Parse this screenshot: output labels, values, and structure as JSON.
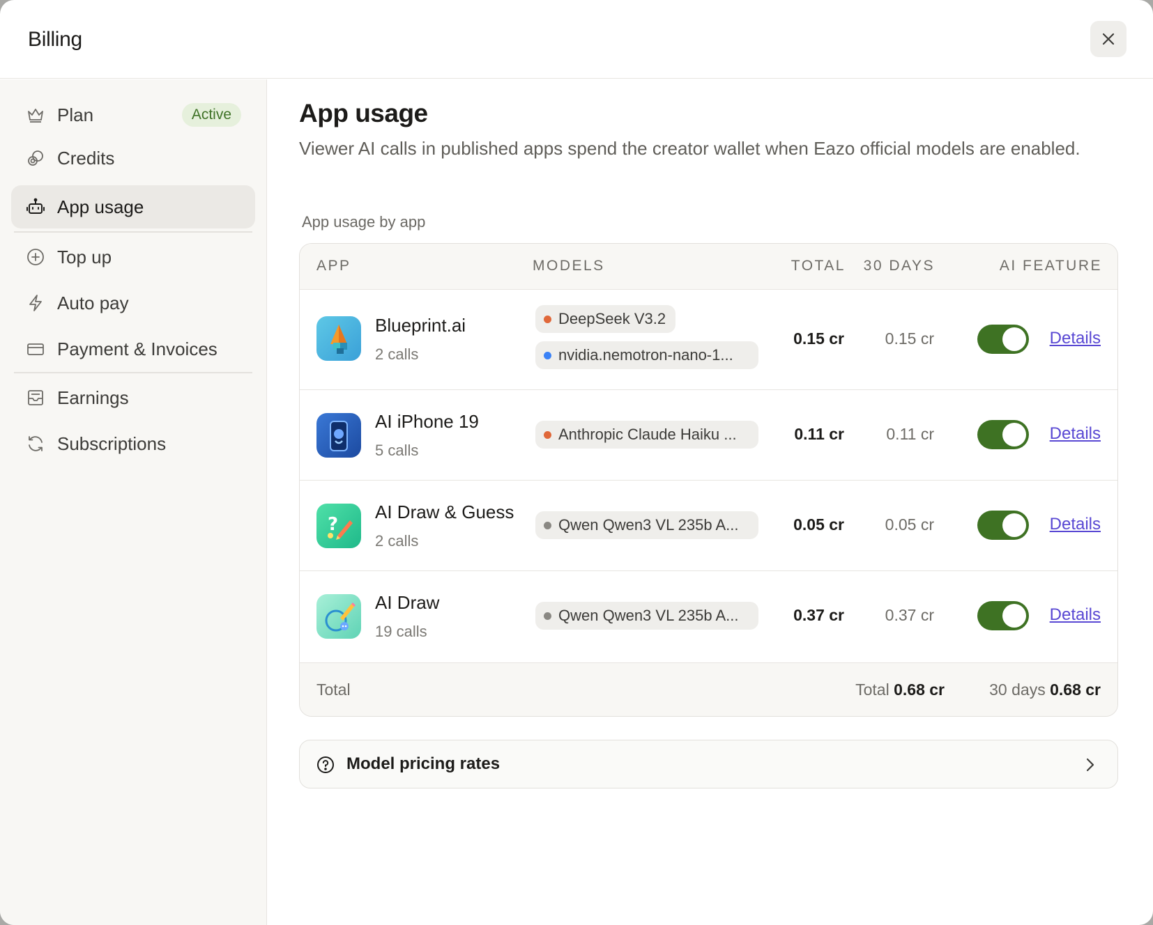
{
  "modal": {
    "title": "Billing",
    "close_label": "Close"
  },
  "sidebar": {
    "items": [
      {
        "label": "Plan",
        "icon": "crown-icon",
        "badge": "Active"
      },
      {
        "label": "Credits",
        "icon": "coins-icon"
      },
      {
        "label": "App usage",
        "icon": "bot-icon",
        "active": true
      },
      {
        "label": "Top up",
        "icon": "plus-circle-icon"
      },
      {
        "label": "Auto pay",
        "icon": "lightning-icon"
      },
      {
        "label": "Payment & Invoices",
        "icon": "credit-card-icon"
      },
      {
        "label": "Earnings",
        "icon": "inbox-icon"
      },
      {
        "label": "Subscriptions",
        "icon": "refresh-icon"
      }
    ]
  },
  "main": {
    "title": "App usage",
    "description": "Viewer AI calls in published apps spend the creator wallet when Eazo official models are enabled.",
    "section_label": "App usage by app",
    "table": {
      "headers": {
        "app": "APP",
        "models": "MODELS",
        "total": "TOTAL",
        "days": "30 DAYS",
        "ai_feature": "AI FEATURE"
      },
      "rows": [
        {
          "name": "Blueprint.ai",
          "calls": "2 calls",
          "models": [
            {
              "label": "DeepSeek V3.2",
              "color": "#e0683a"
            },
            {
              "label": "nvidia.nemotron-nano-1...",
              "color": "#3b82f6"
            }
          ],
          "total": "0.15 cr",
          "days": "0.15 cr",
          "ai_enabled": true,
          "details": "Details"
        },
        {
          "name": "AI iPhone 19",
          "calls": "5 calls",
          "models": [
            {
              "label": "Anthropic Claude Haiku ...",
              "color": "#e0683a"
            }
          ],
          "total": "0.11 cr",
          "days": "0.11 cr",
          "ai_enabled": true,
          "details": "Details"
        },
        {
          "name": "AI Draw & Guess",
          "calls": "2 calls",
          "models": [
            {
              "label": "Qwen Qwen3 VL 235b A...",
              "color": "#8a8883"
            }
          ],
          "total": "0.05 cr",
          "days": "0.05 cr",
          "ai_enabled": true,
          "details": "Details"
        },
        {
          "name": "AI Draw",
          "calls": "19 calls",
          "models": [
            {
              "label": "Qwen Qwen3 VL 235b A...",
              "color": "#8a8883"
            }
          ],
          "total": "0.37 cr",
          "days": "0.37 cr",
          "ai_enabled": true,
          "details": "Details"
        }
      ],
      "footer": {
        "label": "Total",
        "total_label": "Total",
        "total_value": "0.68 cr",
        "days_label": "30 days",
        "days_value": "0.68 cr"
      }
    },
    "pricing": {
      "label": "Model pricing rates"
    }
  },
  "colors": {
    "accent_green": "#3e7223",
    "link": "#5847d3",
    "badge_bg": "#e6f0dc",
    "badge_text": "#3f7227"
  }
}
